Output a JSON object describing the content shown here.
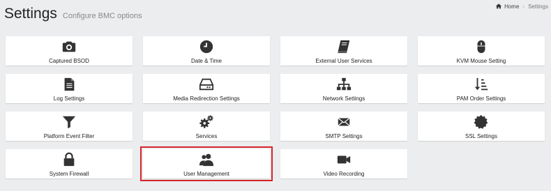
{
  "header": {
    "title": "Settings",
    "subtitle": "Configure BMC options"
  },
  "breadcrumb": {
    "home_label": "Home",
    "separator": "›",
    "current": "Settings"
  },
  "tiles": [
    {
      "label": "Captured BSOD",
      "icon": "camera-icon"
    },
    {
      "label": "Date & Time",
      "icon": "clock-icon"
    },
    {
      "label": "External User Services",
      "icon": "book-icon"
    },
    {
      "label": "KVM Mouse Setting",
      "icon": "mouse-icon"
    },
    {
      "label": "Log Settings",
      "icon": "document-icon"
    },
    {
      "label": "Media Redirection Settings",
      "icon": "hard-drive-icon"
    },
    {
      "label": "Network Settings",
      "icon": "network-icon"
    },
    {
      "label": "PAM Order Settings",
      "icon": "sort-order-icon"
    },
    {
      "label": "Platform Event Filter",
      "icon": "filter-icon"
    },
    {
      "label": "Services",
      "icon": "gears-icon"
    },
    {
      "label": "SMTP Settings",
      "icon": "envelope-icon"
    },
    {
      "label": "SSL Settings",
      "icon": "certificate-icon"
    },
    {
      "label": "System Firewall",
      "icon": "lock-icon"
    },
    {
      "label": "User Management",
      "icon": "users-icon",
      "selected": true
    },
    {
      "label": "Video Recording",
      "icon": "video-camera-icon"
    }
  ],
  "colors": {
    "background": "#ecedee",
    "tile": "#ffffff",
    "selection_outline": "#d6242a",
    "icon": "#333333"
  }
}
